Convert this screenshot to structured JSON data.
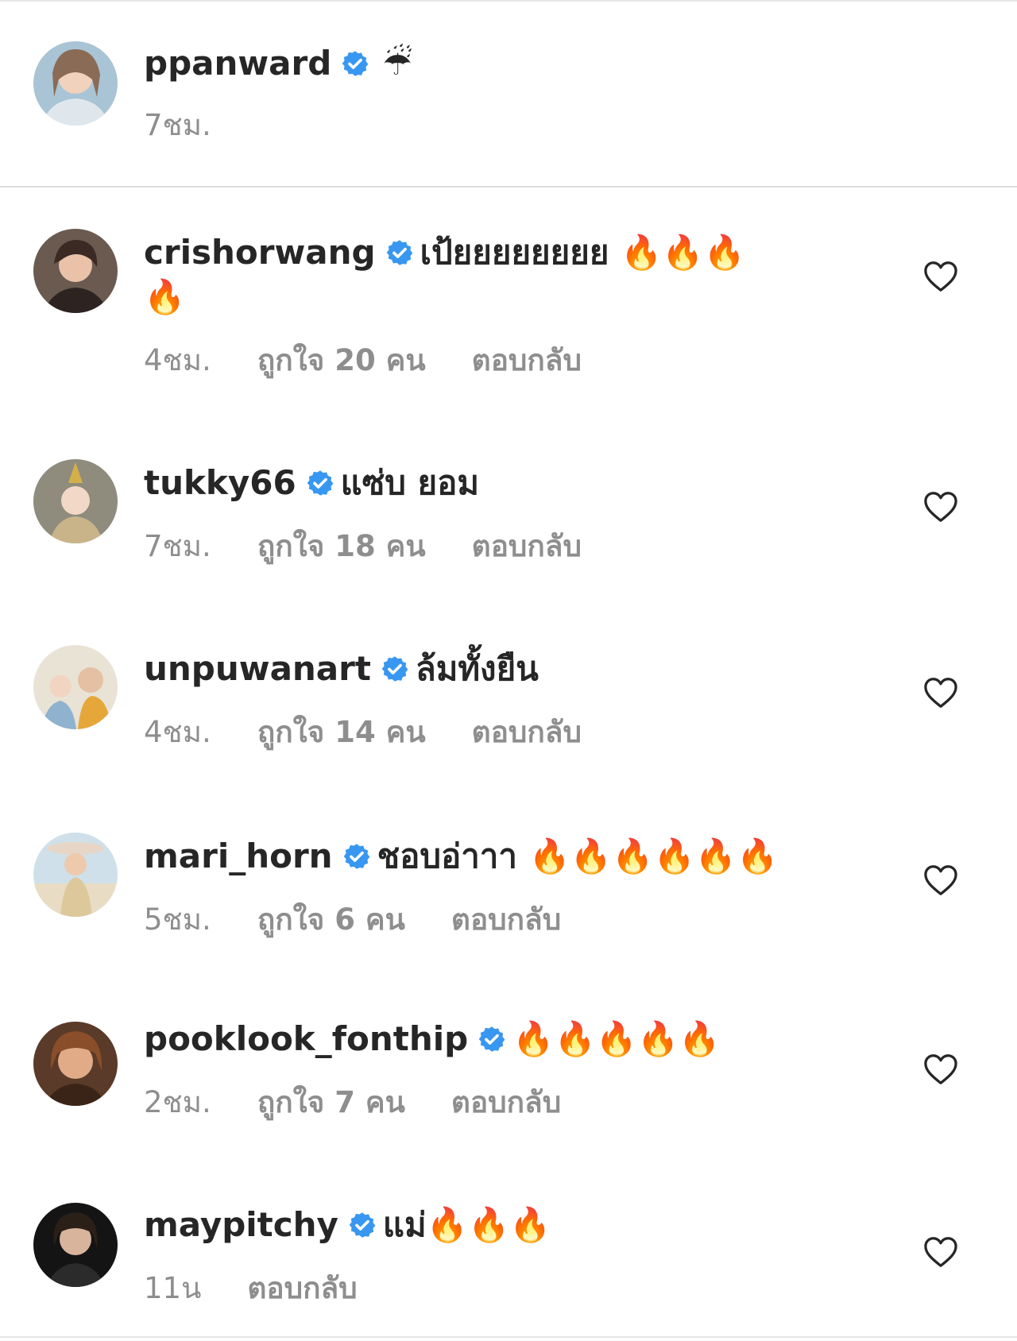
{
  "caption": {
    "username": "ppanward",
    "text": "☔",
    "time": "7ชม."
  },
  "comments": [
    {
      "username": "crishorwang",
      "text": "เป้ยยยยยยยย 🔥🔥🔥",
      "text_cont": "🔥",
      "time": "4ชม.",
      "likes": "ถูกใจ 20 คน",
      "reply": "ตอบกลับ"
    },
    {
      "username": "tukky66",
      "text": "แซ่บ ยอม",
      "time": "7ชม.",
      "likes": "ถูกใจ 18 คน",
      "reply": "ตอบกลับ"
    },
    {
      "username": "unpuwanart",
      "text": "ล้มทั้งยืน",
      "time": "4ชม.",
      "likes": "ถูกใจ 14 คน",
      "reply": "ตอบกลับ"
    },
    {
      "username": "mari_horn",
      "text": "ชอบอ่าาา 🔥🔥🔥🔥🔥🔥",
      "time": "5ชม.",
      "likes": "ถูกใจ 6 คน",
      "reply": "ตอบกลับ"
    },
    {
      "username": "pooklook_fonthip",
      "text": "🔥🔥🔥🔥🔥",
      "time": "2ชม.",
      "likes": "ถูกใจ 7 คน",
      "reply": "ตอบกลับ"
    },
    {
      "username": "maypitchy",
      "text": "แม่🔥🔥🔥",
      "time": "11น",
      "reply": "ตอบกลับ"
    }
  ],
  "icons": {
    "verified": "verified-badge-icon",
    "like": "heart-outline-icon"
  },
  "colors": {
    "verified_blue": "#3897f0",
    "meta_gray": "#8e8e8e",
    "text": "#262626"
  }
}
